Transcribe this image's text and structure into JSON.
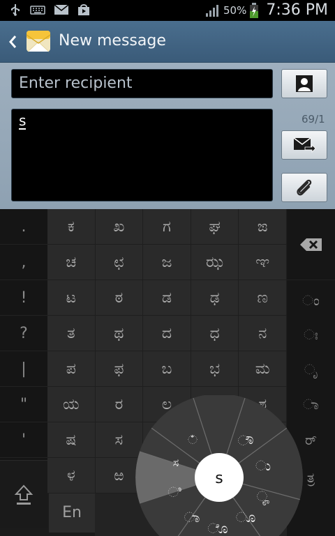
{
  "status_bar": {
    "battery_percent": "50%",
    "time": "7:36 PM",
    "left_icons": [
      "usb-icon",
      "keyboard-icon",
      "email-icon",
      "store-icon"
    ]
  },
  "title_bar": {
    "title": "New message"
  },
  "compose": {
    "recipient_placeholder": "Enter recipient",
    "message_text": "s",
    "char_counter": "69/1"
  },
  "keyboard": {
    "left_column": [
      ".",
      ",",
      "!",
      "?",
      "|",
      "\"",
      "'"
    ],
    "grid_rows": [
      [
        "ಕ",
        "ಖ",
        "ಗ",
        "ಘ",
        "ಙ"
      ],
      [
        "ಚ",
        "ಛ",
        "ಜ",
        "ಝ",
        "ಞ"
      ],
      [
        "ಟ",
        "ಠ",
        "ಡ",
        "ಢ",
        "ಣ"
      ],
      [
        "ತ",
        "ಥ",
        "ದ",
        "ಧ",
        "ನ"
      ],
      [
        "ಪ",
        "ಫ",
        "ಬ",
        "ಭ",
        "ಮ"
      ],
      [
        "ಯ",
        "ರ",
        "ಲ",
        "",
        "ಶ"
      ],
      [
        "ಷ",
        "ಸ",
        "",
        "",
        ""
      ],
      [
        "ಳ",
        "ಱ",
        "",
        "",
        ""
      ]
    ],
    "right_column": [
      "ಂ",
      "ಃ",
      "ೃ",
      "ಾ",
      "ರ್",
      "ತ್ರ"
    ],
    "language_label": "En",
    "radial": {
      "center": "s",
      "segments": [
        "ೌ",
        "ು",
        "ೄ",
        "ೂ",
        "ೊ",
        "ಾ",
        "ಿ",
        "ಸ",
        "ಁ"
      ]
    }
  }
}
